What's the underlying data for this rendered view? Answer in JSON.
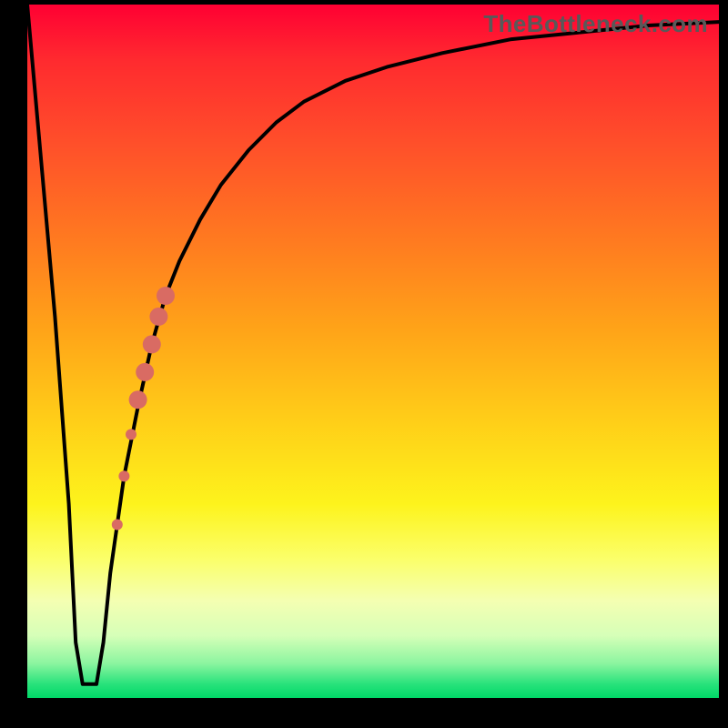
{
  "brand": "TheBottleneck.com",
  "chart_data": {
    "type": "line",
    "title": "",
    "xlabel": "",
    "ylabel": "",
    "xlim": [
      0,
      100
    ],
    "ylim": [
      0,
      100
    ],
    "grid": false,
    "background": "heat-gradient",
    "series": [
      {
        "name": "bottleneck-curve",
        "color": "#000000",
        "x": [
          0,
          4,
          6,
          7,
          8,
          9,
          10,
          11,
          12,
          14,
          16,
          18,
          20,
          22,
          25,
          28,
          32,
          36,
          40,
          46,
          52,
          60,
          70,
          80,
          90,
          100
        ],
        "y": [
          100,
          55,
          28,
          8,
          2,
          2,
          2,
          8,
          18,
          32,
          42,
          51,
          58,
          63,
          69,
          74,
          79,
          83,
          86,
          89,
          91,
          93,
          95,
          96,
          97,
          97.5
        ]
      }
    ],
    "markers": {
      "name": "highlight-points",
      "color": "#d96b63",
      "points": [
        {
          "x": 13.0,
          "y": 25,
          "r": 6
        },
        {
          "x": 14.0,
          "y": 32,
          "r": 6
        },
        {
          "x": 15.0,
          "y": 38,
          "r": 6
        },
        {
          "x": 16.0,
          "y": 43,
          "r": 10
        },
        {
          "x": 17.0,
          "y": 47,
          "r": 10
        },
        {
          "x": 18.0,
          "y": 51,
          "r": 10
        },
        {
          "x": 19.0,
          "y": 55,
          "r": 10
        },
        {
          "x": 20.0,
          "y": 58,
          "r": 10
        }
      ]
    }
  }
}
